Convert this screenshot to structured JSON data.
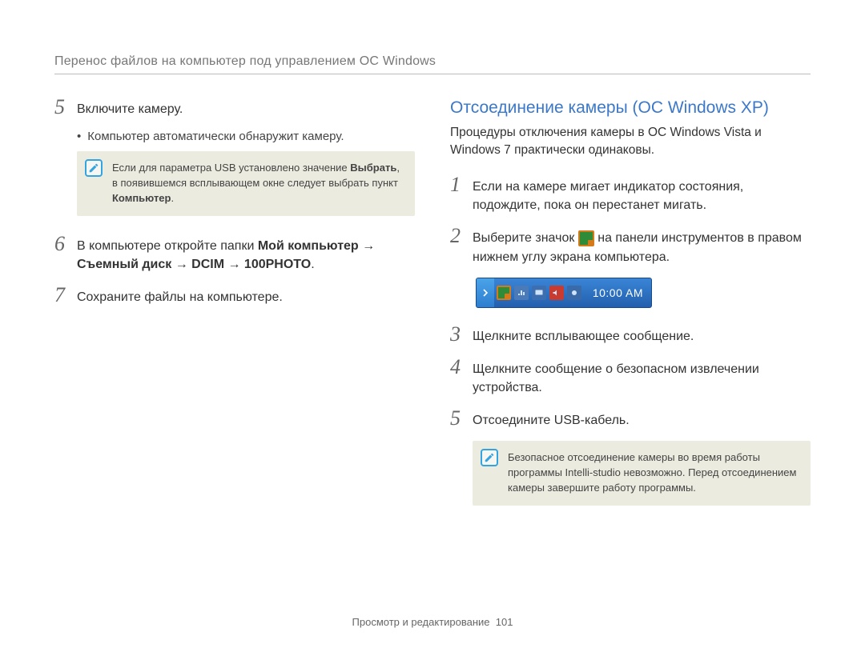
{
  "header": "Перенос файлов на компьютер под управлением ОС Windows",
  "left": {
    "step5": {
      "num": "5",
      "text": "Включите камеру."
    },
    "step5_bullet": "Компьютер автоматически обнаружит камеру.",
    "note1_pre": "Если для параметра USB установлено значение ",
    "note1_b1": "Выбрать",
    "note1_mid": ", в появившемся всплывающем окне следует выбрать пункт ",
    "note1_b2": "Компьютер",
    "note1_post": ".",
    "step6": {
      "num": "6",
      "pre": "В компьютере откройте папки ",
      "b1": "Мой компьютер",
      "arr1": " → ",
      "b2": "Съемный диск",
      "arr2": " → ",
      "b3": "DCIM",
      "arr3": " → ",
      "b4": "100PHOTO",
      "post": "."
    },
    "step7": {
      "num": "7",
      "text": "Сохраните файлы на компьютере."
    }
  },
  "right": {
    "title": "Отсоединение камеры (ОС Windows XP)",
    "intro": "Процедуры отключения камеры в ОС Windows Vista и Windows 7 практически одинаковы.",
    "step1": {
      "num": "1",
      "text": "Если на камере мигает индикатор состояния, подождите, пока он перестанет мигать."
    },
    "step2": {
      "num": "2",
      "pre": "Выберите значок ",
      "post": " на панели инструментов в правом нижнем углу экрана компьютера."
    },
    "clock": "10:00 AM",
    "step3": {
      "num": "3",
      "text": "Щелкните всплывающее сообщение."
    },
    "step4": {
      "num": "4",
      "text": "Щелкните сообщение о безопасном извлечении устройства."
    },
    "step5": {
      "num": "5",
      "text": "Отсоедините USB-кабель."
    },
    "note2": "Безопасное отсоединение камеры во время работы программы Intelli-studio невозможно. Перед отсоединением камеры завершите работу программы."
  },
  "footer": {
    "section": "Просмотр и редактирование",
    "page": "101"
  }
}
